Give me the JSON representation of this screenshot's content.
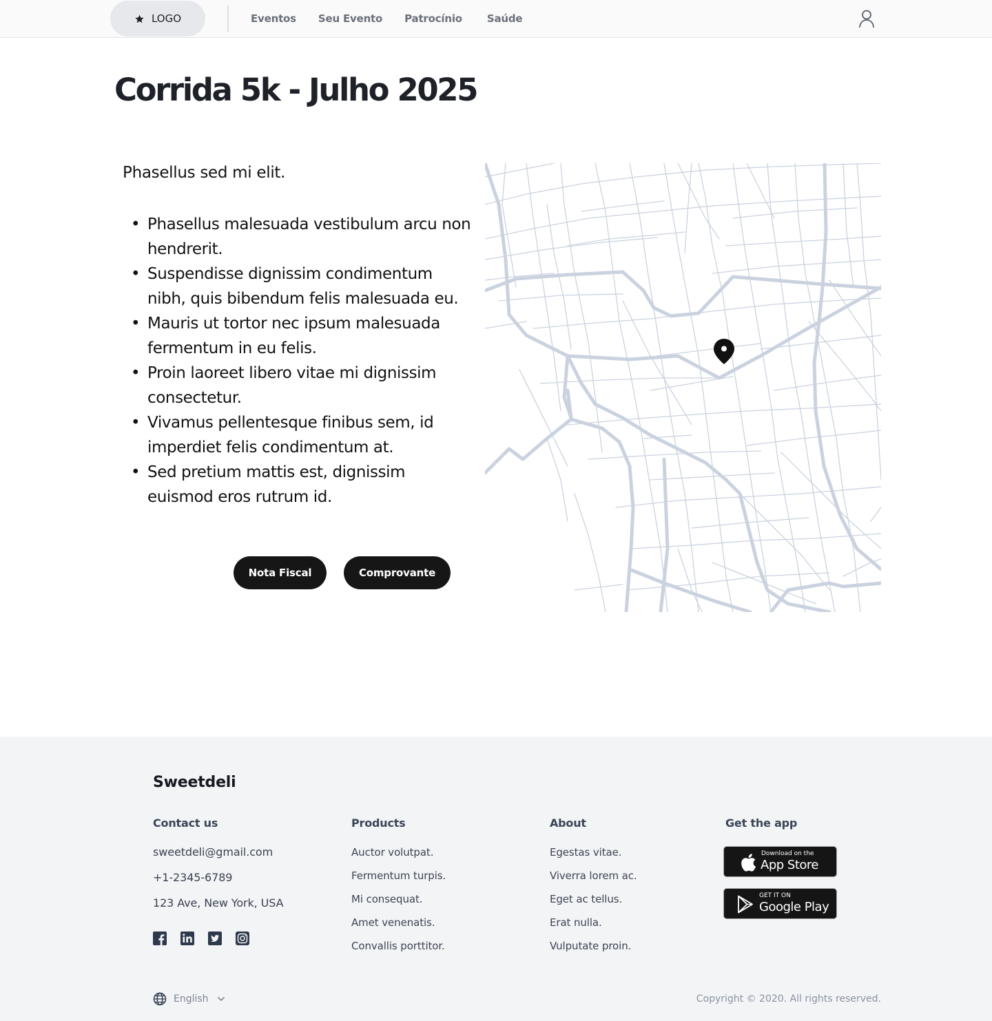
{
  "header": {
    "logo_text": "LOGO",
    "nav": [
      "Eventos",
      "Seu Evento",
      "Patrocínio",
      "Saúde"
    ]
  },
  "page": {
    "title": "Corrida 5k - Julho 2025",
    "intro": "Phasellus sed mi elit.",
    "bullets": [
      "Phasellus malesuada vestibulum arcu non hendrerit.",
      "Suspendisse dignissim condimentum nibh, quis bibendum felis malesuada eu.",
      "Mauris ut tortor nec ipsum malesuada fermentum in eu felis.",
      "Proin laoreet libero vitae mi dignissim consectetur.",
      "Vivamus pellentesque finibus sem, id imperdiet felis condimentum at.",
      "Sed pretium mattis est, dignissim euismod eros rutrum id."
    ],
    "buttons": {
      "nota": "Nota Fiscal",
      "comprovante": "Comprovante"
    }
  },
  "footer": {
    "brand": "Sweetdeli",
    "contact": {
      "title": "Contact us",
      "email": "sweetdeli@gmail.com",
      "phone": "+1-2345-6789",
      "address": "123 Ave, New York, USA"
    },
    "products": {
      "title": "Products",
      "items": [
        "Auctor volutpat.",
        "Fermentum turpis.",
        "Mi consequat.",
        "Amet venenatis.",
        "Convallis porttitor."
      ]
    },
    "about": {
      "title": "About",
      "items": [
        "Egestas vitae.",
        "Viverra lorem ac.",
        "Eget ac tellus.",
        "Erat nulla.",
        "Vulputate proin."
      ]
    },
    "app": {
      "title": "Get the app",
      "appstore_small": "Download on the",
      "appstore_big": "App Store",
      "googleplay_small": "GET IT ON",
      "googleplay_big": "Google Play"
    },
    "language": "English",
    "copyright": "Copyright © 2020. All rights reserved."
  },
  "colors": {
    "map_roads": "#cbd2df",
    "button_bg": "#161616",
    "footer_bg": "#f3f4f6"
  },
  "icons": [
    "star-icon",
    "user-icon",
    "map-pin-icon",
    "facebook-icon",
    "linkedin-icon",
    "twitter-icon",
    "instagram-icon",
    "apple-icon",
    "google-play-icon",
    "globe-icon",
    "chevron-down-icon"
  ]
}
